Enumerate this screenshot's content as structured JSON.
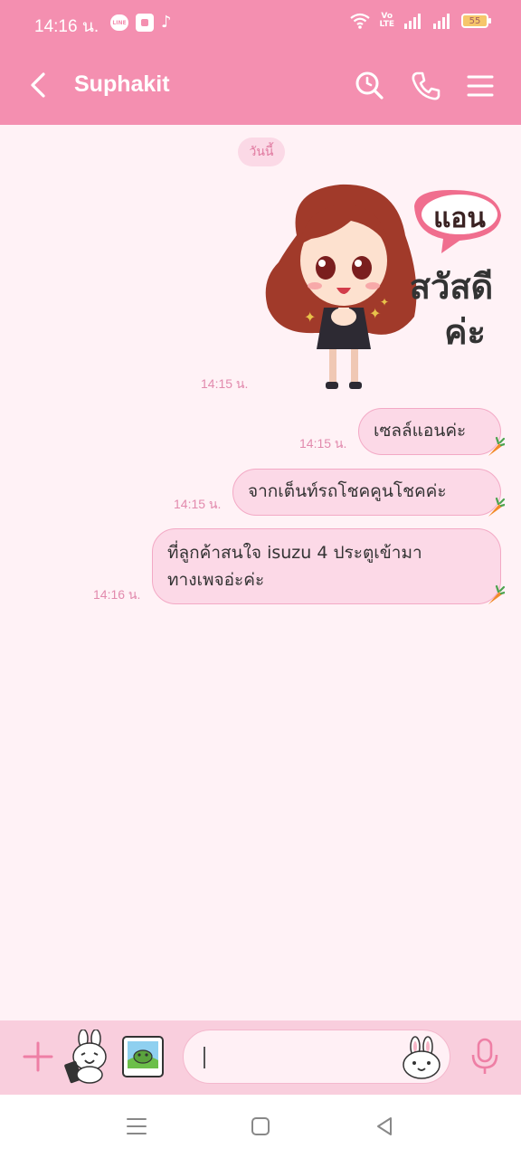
{
  "status_bar": {
    "time": "14:16 น.",
    "app_line_label": "LINE",
    "network_label": "VoLTE",
    "battery": "55"
  },
  "header": {
    "title": "Suphakit"
  },
  "chat": {
    "date_label": "วันนี้",
    "sticker": {
      "name_tag": "แอน",
      "greeting_line1": "สวัสดี",
      "greeting_line2": "ค่ะ",
      "time": "14:15 น."
    },
    "messages": [
      {
        "lines": [
          "เซลล์แอนค่ะ"
        ],
        "time": "14:15 น."
      },
      {
        "lines": [
          "จากเต็นท์รถโชคคูนโชคค่ะ"
        ],
        "time": "14:15 น."
      },
      {
        "lines": [
          "ที่ลูกค้าสนใจ isuzu 4 ประตูเข้ามา",
          "ทางเพจอ่ะค่ะ"
        ],
        "time": "14:16 น."
      }
    ]
  },
  "input": {
    "value": ""
  },
  "colors": {
    "header_bg": "#f48fb0",
    "chat_bg": "#fff2f6",
    "bubble_bg": "#fcd9e7",
    "timestamp": "#e28aad",
    "input_bar_bg": "#f9cedd"
  },
  "icons": {
    "back": "chevron-left-icon",
    "search": "search-clock-icon",
    "call": "phone-icon",
    "menu": "hamburger-menu-icon",
    "plus": "plus-icon",
    "sticker": "bunny-sticker-icon",
    "gallery": "gallery-icon",
    "emoji": "bunny-emoji-icon",
    "mic": "microphone-icon",
    "carrot": "carrot-icon"
  }
}
